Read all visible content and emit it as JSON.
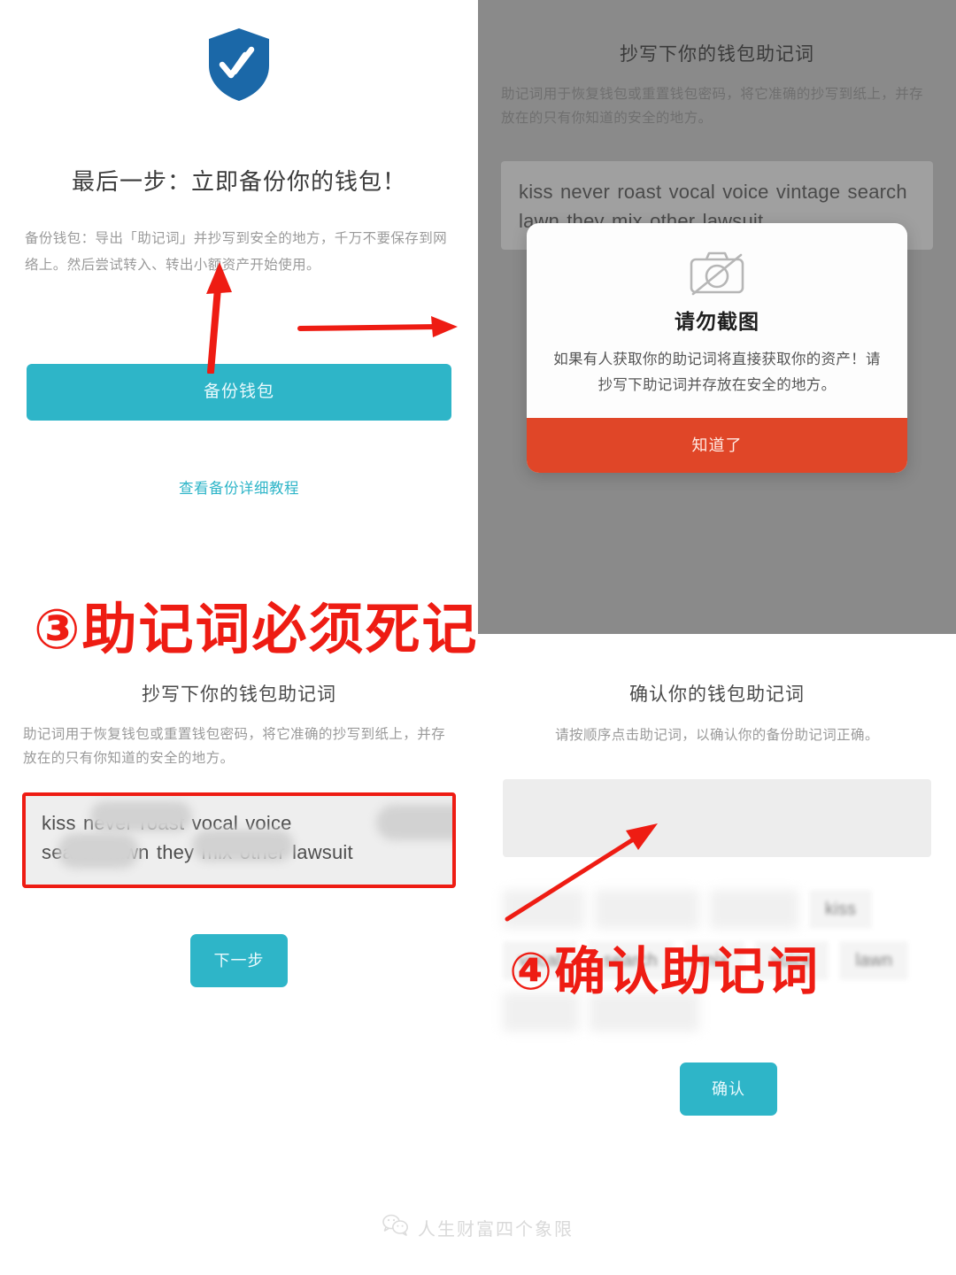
{
  "screens": {
    "backup": {
      "icon": "shield-check-icon",
      "title": "最后一步：立即备份你的钱包！",
      "description": "备份钱包：导出「助记词」并抄写到安全的地方，千万不要保存到网络上。然后尝试转入、转出小额资产开始使用。",
      "primary_button": "备份钱包",
      "tutorial_link": "查看备份详细教程"
    },
    "write_mnemonic_dimmed": {
      "title": "抄写下你的钱包助记词",
      "description": "助记词用于恢复钱包或重置钱包密码，将它准确的抄写到纸上，并存放在的只有你知道的安全的地方。",
      "mnemonic": "kiss never roast vocal voice vintage search lawn they mix other lawsuit"
    },
    "write_mnemonic": {
      "title": "抄写下你的钱包助记词",
      "description": "助记词用于恢复钱包或重置钱包密码，将它准确的抄写到纸上，并存放在的只有你知道的安全的地方。",
      "mnemonic_line1": "kiss never roast vocal voice",
      "mnemonic_line2": "search lawn they mix other lawsuit",
      "next_button": "下一步"
    },
    "confirm_mnemonic": {
      "title": "确认你的钱包助记词",
      "description": "请按顺序点击助记词，以确认你的备份助记词正确。",
      "selection_placeholder": "",
      "word_chips": [
        {
          "label": "",
          "blurred": true
        },
        {
          "label": "",
          "blurred": true
        },
        {
          "label": "",
          "blurred": true
        },
        {
          "label": "kiss",
          "blurred": false
        },
        {
          "label": "vocal",
          "blurred": false
        },
        {
          "label": "search",
          "blurred": false
        },
        {
          "label": "mix",
          "blurred": false
        },
        {
          "label": "voice",
          "blurred": false
        },
        {
          "label": "lawn",
          "blurred": false
        },
        {
          "label": "",
          "blurred": true
        },
        {
          "label": "",
          "blurred": true
        }
      ],
      "confirm_button": "确认"
    }
  },
  "modal": {
    "icon": "no-camera-icon",
    "title": "请勿截图",
    "message": "如果有人获取你的助记词将直接获取你的资产！请抄写下助记词并存放在安全的地方。",
    "ok_button": "知道了"
  },
  "annotations": {
    "step3": "③助记词必须死记",
    "step4": "④确认助记词"
  },
  "footer": {
    "icon": "wechat-icon",
    "account_name": "人生财富四个象限"
  },
  "colors": {
    "teal": "#2EB5C8",
    "red": "#E04628",
    "annotation_red": "#EE1C13",
    "shield_blue": "#1B68A8",
    "dim_overlay": "#8A8A8A"
  }
}
